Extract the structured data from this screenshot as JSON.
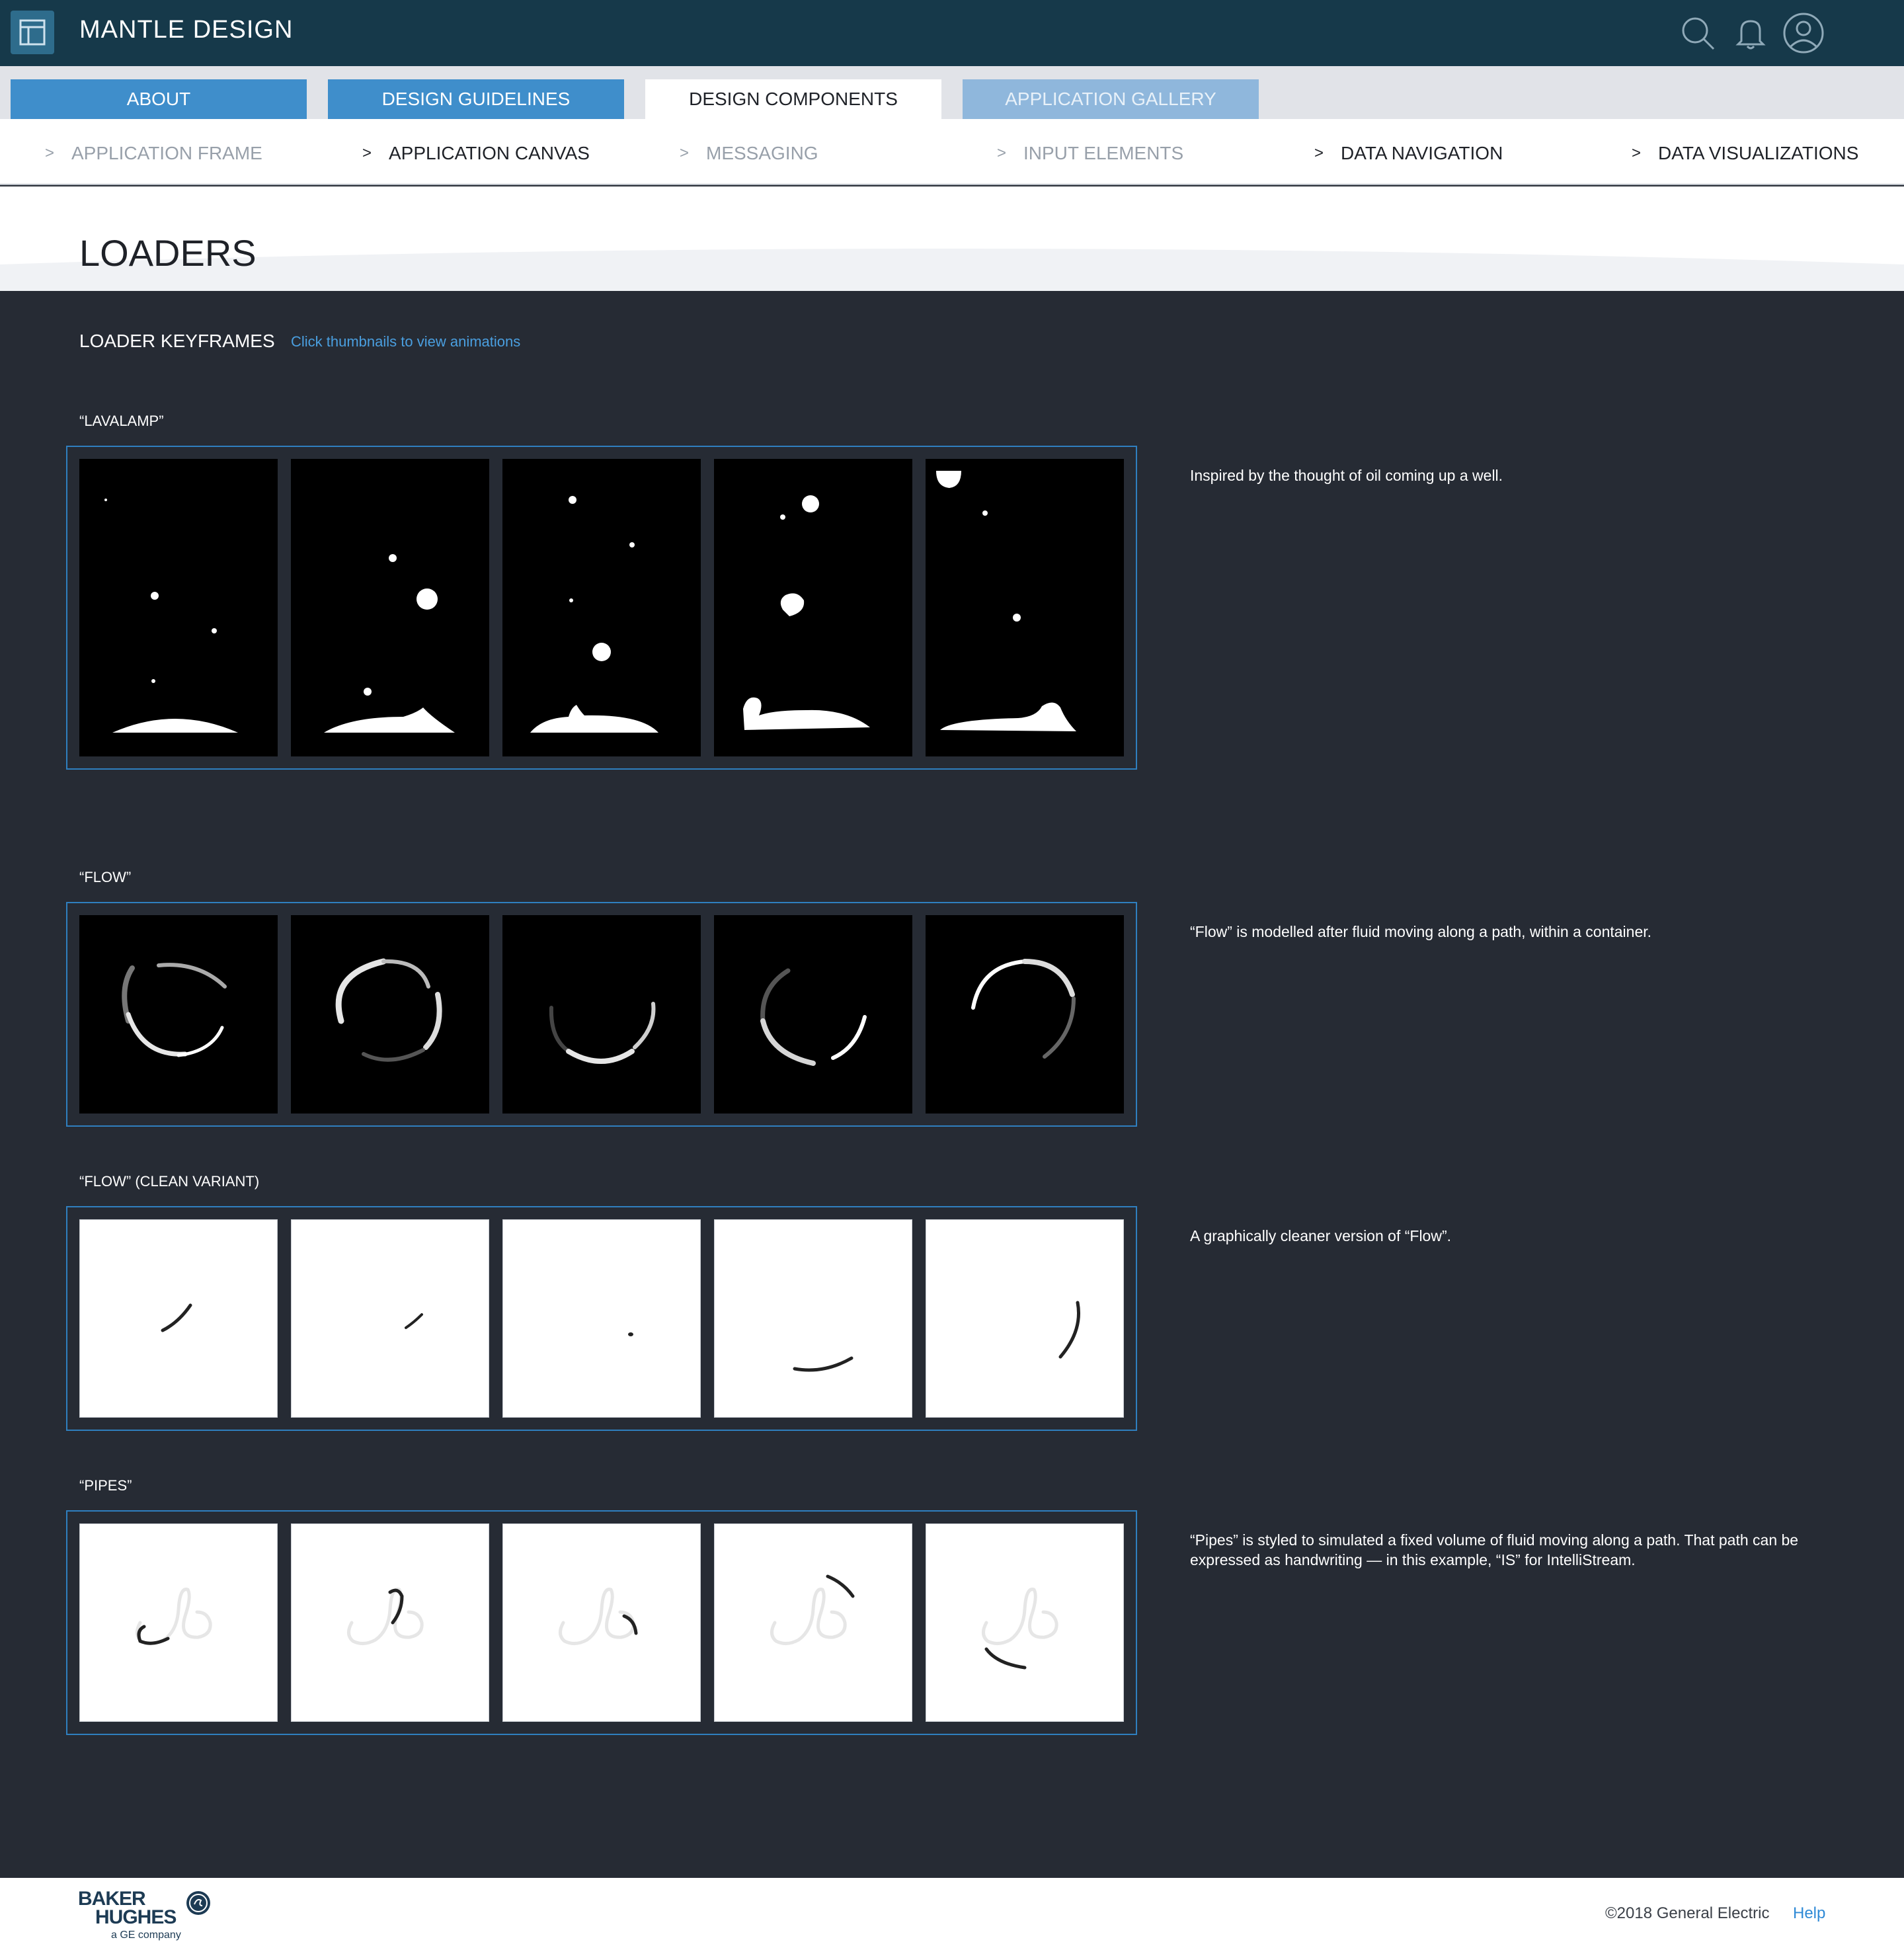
{
  "header": {
    "app_title": "MANTLE DESIGN",
    "icons": [
      "app-menu-icon",
      "search-icon",
      "bell-icon",
      "user-icon"
    ]
  },
  "tabs": [
    {
      "label": "ABOUT",
      "state": "normal"
    },
    {
      "label": "DESIGN GUIDELINES",
      "state": "normal"
    },
    {
      "label": "DESIGN COMPONENTS",
      "state": "active"
    },
    {
      "label": "APPLICATION GALLERY",
      "state": "disabled"
    }
  ],
  "subnav": [
    {
      "label": "APPLICATION FRAME",
      "state": "dim"
    },
    {
      "label": "APPLICATION CANVAS",
      "state": "normal"
    },
    {
      "label": "MESSAGING",
      "state": "dim"
    },
    {
      "label": "INPUT ELEMENTS",
      "state": "dim"
    },
    {
      "label": "DATA NAVIGATION",
      "state": "normal"
    },
    {
      "label": "DATA VISUALIZATIONS",
      "state": "normal"
    }
  ],
  "page": {
    "title": "LOADERS",
    "keyframes_title": "LOADER KEYFRAMES",
    "keyframes_hint": "Click thumbnails to view animations"
  },
  "sections": [
    {
      "label": "“LAVALAMP”",
      "description": "Inspired by the thought of oil coming up a well."
    },
    {
      "label": "“FLOW”",
      "description": "“Flow” is modelled after fluid moving along a path, within a container."
    },
    {
      "label": "“FLOW” (CLEAN VARIANT)",
      "description": "A graphically cleaner version of “Flow”."
    },
    {
      "label": "“PIPES”",
      "description": "“Pipes” is styled to simulated a fixed volume of fluid moving along a path. That path can be expressed as handwriting — in this example, “IS” for IntelliStream."
    }
  ],
  "footer": {
    "logo_line1": "BAKER",
    "logo_line2": "HUGHES",
    "logo_sub": "a GE company",
    "copyright": "©2018 General Electric",
    "help": "Help"
  },
  "colors": {
    "header_bg": "#16394a",
    "tab_blue": "#3f8ecb",
    "main_bg": "#262b34",
    "strip_border": "#2f7fbf",
    "hint_link": "#4a9fe0"
  }
}
